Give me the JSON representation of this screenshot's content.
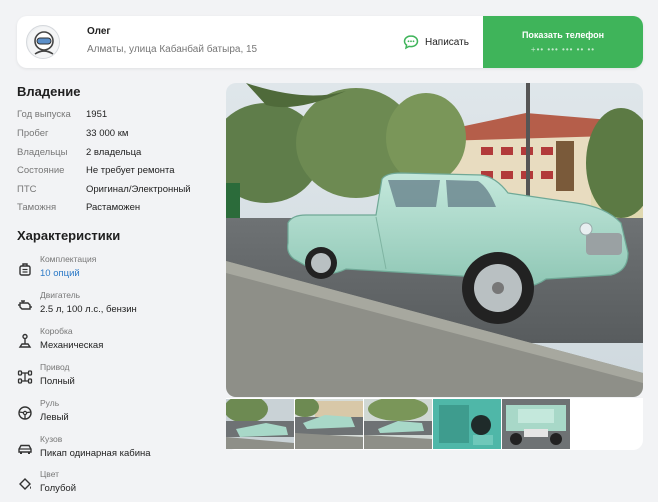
{
  "seller": {
    "name": "Олег",
    "address": "Алматы, улица Кабанбай батыра, 15",
    "write_label": "Написать",
    "phone_label": "Показать телефон",
    "phone_masked": "+•• ••• ••• •• ••"
  },
  "ownership": {
    "title": "Владение",
    "rows": [
      {
        "key": "Год выпуска",
        "value": "1951"
      },
      {
        "key": "Пробег",
        "value": "33 000 км"
      },
      {
        "key": "Владельцы",
        "value": "2 владельца"
      },
      {
        "key": "Состояние",
        "value": "Не требует ремонта"
      },
      {
        "key": "ПТС",
        "value": "Оригинал/Электронный"
      },
      {
        "key": "Таможня",
        "value": "Растаможен"
      }
    ]
  },
  "specs": {
    "title": "Характеристики",
    "items": [
      {
        "icon": "equipment-icon",
        "key": "Комплектация",
        "value": "10 опций"
      },
      {
        "icon": "engine-icon",
        "key": "Двигатель",
        "value": "2.5 л, 100 л.с., бензин"
      },
      {
        "icon": "gearbox-icon",
        "key": "Коробка",
        "value": "Механическая"
      },
      {
        "icon": "drive-icon",
        "key": "Привод",
        "value": "Полный"
      },
      {
        "icon": "steering-wheel-icon",
        "key": "Руль",
        "value": "Левый"
      },
      {
        "icon": "car-body-icon",
        "key": "Кузов",
        "value": "Пикап одинарная кабина"
      },
      {
        "icon": "paint-icon",
        "key": "Цвет",
        "value": "Голубой"
      }
    ]
  },
  "colors": {
    "accent_green": "#3fb45a",
    "link_blue": "#2d7ac7",
    "car_mint": "#a8d8c8"
  }
}
